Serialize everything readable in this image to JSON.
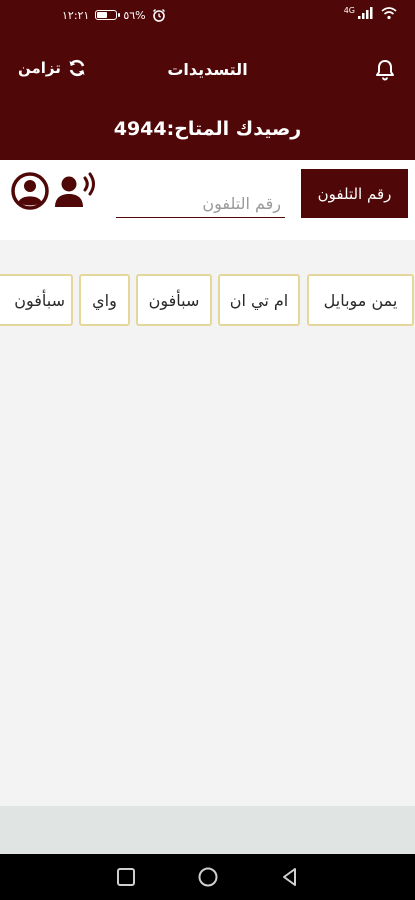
{
  "status_bar": {
    "time": "١٢:٢١",
    "battery": "٥٦%",
    "battery_level": 0.56,
    "network": "4G"
  },
  "header": {
    "title": "التسديدات",
    "sync_label": "تزامن",
    "balance_text": "رصيدك المتاح:4944"
  },
  "phone": {
    "type_button_label": "رقم التلفون",
    "input_placeholder": "رقم التلفون",
    "input_value": ""
  },
  "operators": [
    {
      "label": "يمن موبايل"
    },
    {
      "label": "ام تي ان"
    },
    {
      "label": "سبأفون"
    },
    {
      "label": "واي"
    },
    {
      "label": "سبأفون"
    }
  ],
  "colors": {
    "primary": "#4f0707",
    "chip_border": "#e5d79a",
    "background": "#f3f3f3"
  },
  "icons": {
    "sync": "sync-icon",
    "bell": "bell-icon",
    "contacts": "contacts-icon",
    "voice": "voice-icon"
  }
}
